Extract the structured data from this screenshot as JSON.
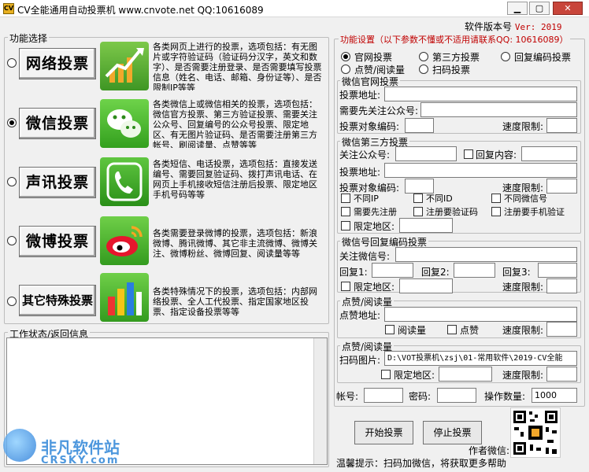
{
  "window": {
    "title": "CV全能通用自动投票机  www.cnvote.net  QQ:10616089"
  },
  "version": {
    "label": "软件版本号",
    "value": "Ver: 2019"
  },
  "functions": {
    "legend": "功能选择",
    "items": [
      {
        "label": "网络投票",
        "selected": false,
        "desc": "各类网页上进行的投票，选项包括：有无图片或字符验证码（验证码分汉字，英文和数字）、是否需要注册登录、是否需要填写投票信息（姓名、电话、邮箱、身份证等）、是否限制IP等等"
      },
      {
        "label": "微信投票",
        "selected": true,
        "desc": "各类微信上或微信相关的投票，选项包括：微信官方投票、第三方验证投票、需要关注公众号、回复编号的公众号投票、限定地区、有无图片验证码、是否需要注册第三方帐号、刷阅读量、点赞等等"
      },
      {
        "label": "声讯投票",
        "selected": false,
        "desc": "各类短信、电话投票，选项包括：直接发送编号、需要回复验证码、拨打声讯电话、在网页上手机接收短信注册后投票、限定地区手机号码等等"
      },
      {
        "label": "微博投票",
        "selected": false,
        "desc": "各类需要登录微博的投票，选项包括：新浪微博、腾讯微博、其它非主流微博、微博关注、微博粉丝、微博回复、阅读量等等"
      },
      {
        "label": "其它特殊投票",
        "selected": false,
        "desc": "各类特殊情况下的投票，选项包括：内部网络投票、全人工代投票、指定国家地区投票、指定设备投票等等"
      }
    ]
  },
  "status": {
    "legend": "工作状态/返回信息"
  },
  "settings": {
    "legend": "功能设置（以下参数不懂或不适用请联系QQ: 10616089）",
    "modes": [
      {
        "label": "官网投票",
        "selected": true
      },
      {
        "label": "第三方投票",
        "selected": false
      },
      {
        "label": "回复编码投票",
        "selected": false
      },
      {
        "label": "点赞/阅读量",
        "selected": false
      },
      {
        "label": "扫码投票",
        "selected": false
      }
    ],
    "official": {
      "legend": "微信官网投票",
      "vote_url": "投票地址:",
      "follow_account": "需要先关注公众号:",
      "target_code": "投票对象编码:",
      "speed_limit": "速度限制:"
    },
    "third": {
      "legend": "微信第三方投票",
      "follow_account": "关注公众号:",
      "reply_content": "回复内容:",
      "vote_url": "投票地址:",
      "target_code": "投票对象编码:",
      "speed_limit": "速度限制:",
      "options": [
        "不同IP",
        "不同ID",
        "不同微信号",
        "需要先注册",
        "注册要验证码",
        "注册要手机验证"
      ],
      "region": "限定地区:"
    },
    "reply": {
      "legend": "微信号回复编码投票",
      "follow_account": "关注微信号:",
      "reply1": "回复1:",
      "reply2": "回复2:",
      "reply3": "回复3:",
      "region": "限定地区:",
      "speed_limit": "速度限制:"
    },
    "like": {
      "legend": "点赞/阅读量",
      "url": "点赞地址:",
      "read": "阅读量",
      "like": "点赞",
      "speed_limit": "速度限制:"
    },
    "scan": {
      "legend": "点赞/阅读量",
      "image_label": "扫码图片:",
      "image_path": "D:\\VOT投票机\\zsj\\01-常用软件\\2019-CV全能",
      "region": "限定地区:",
      "speed_limit": "速度限制:"
    },
    "account": "帐号:",
    "password": "密码:",
    "op_count_label": "操作数量:",
    "op_count_value": "1000",
    "start": "开始投票",
    "stop": "停止投票",
    "author_wechat": "作者微信:",
    "hint": "温馨提示：扫码加微信，将获取更多帮助"
  },
  "watermark": {
    "cn": "非凡软件站",
    "en": "CRSKY.com"
  },
  "colors": {
    "accent_red": "#c00000"
  }
}
